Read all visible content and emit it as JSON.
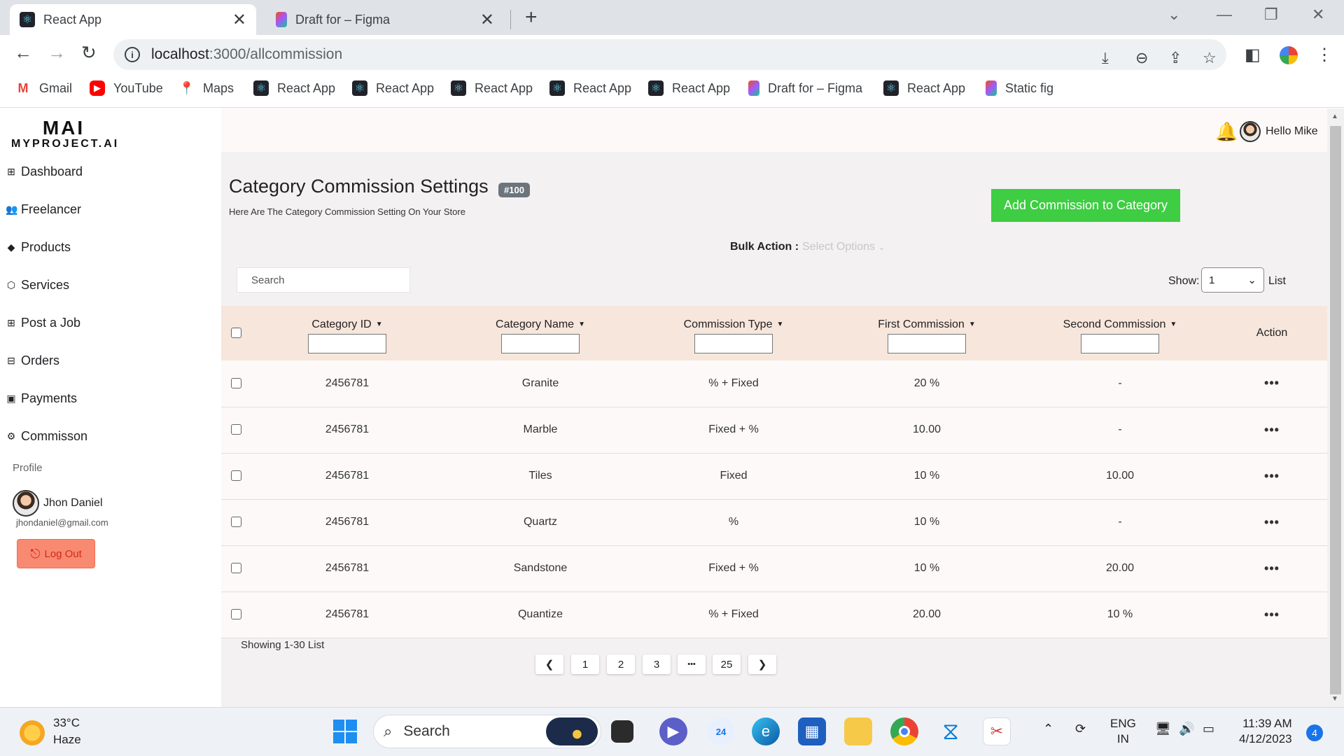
{
  "browser": {
    "tabs": [
      {
        "title": "React App",
        "close": "✕"
      },
      {
        "title": "Draft for – Figma",
        "close": "✕"
      }
    ],
    "url_host": "localhost",
    "url_rest": ":3000/allcommission",
    "bookmarks": [
      {
        "label": "Gmail",
        "icon": "gmail-icon"
      },
      {
        "label": "YouTube",
        "icon": "youtube-icon"
      },
      {
        "label": "Maps",
        "icon": "maps-icon"
      },
      {
        "label": "React App",
        "icon": "react-icon"
      },
      {
        "label": "React App",
        "icon": "react-icon"
      },
      {
        "label": "React App",
        "icon": "react-icon"
      },
      {
        "label": "React App",
        "icon": "react-icon"
      },
      {
        "label": "React App",
        "icon": "react-icon"
      },
      {
        "label": "Draft for – Figma",
        "icon": "figma-icon"
      },
      {
        "label": "React App",
        "icon": "react-icon"
      },
      {
        "label": "Static fig",
        "icon": "figma-icon"
      }
    ]
  },
  "sidebar": {
    "logo_top": "MAI",
    "logo_bottom": "MYPROJECT.AI",
    "items": [
      {
        "label": "Dashboard",
        "icon": "grid-icon"
      },
      {
        "label": "Freelancer",
        "icon": "users-icon"
      },
      {
        "label": "Products",
        "icon": "tag-icon"
      },
      {
        "label": "Services",
        "icon": "box-icon"
      },
      {
        "label": "Post a Job",
        "icon": "plus-square-icon"
      },
      {
        "label": "Orders",
        "icon": "archive-icon"
      },
      {
        "label": "Payments",
        "icon": "wallet-icon"
      },
      {
        "label": "Commisson",
        "icon": "gear-icon"
      }
    ],
    "profile_label": "Profile",
    "user_name": "Jhon Daniel",
    "user_email": "jhondaniel@gmail.com",
    "logout_label": "Log Out"
  },
  "header": {
    "greeting": "Hello Mike"
  },
  "page": {
    "title": "Category Commission Settings",
    "badge": "#100",
    "subtitle": "Here Are The Category Commission Setting On Your Store",
    "add_button": "Add Commission to Category",
    "bulk_label": "Bulk Action :",
    "bulk_placeholder": "Select Options",
    "search_placeholder": "Search",
    "show_label": "Show:",
    "show_value": "1",
    "list_label": "List"
  },
  "table": {
    "columns": [
      "Category ID",
      "Category Name",
      "Commission Type",
      "First Commission",
      "Second Commission",
      "Action"
    ],
    "rows": [
      [
        "2456781",
        "Granite",
        "% + Fixed",
        "20 %",
        "-"
      ],
      [
        "2456781",
        "Marble",
        "Fixed + %",
        "10.00",
        "-"
      ],
      [
        "2456781",
        "Tiles",
        "Fixed",
        "10 %",
        "10.00"
      ],
      [
        "2456781",
        "Quartz",
        "%",
        "10 %",
        "-"
      ],
      [
        "2456781",
        "Sandstone",
        "Fixed + %",
        "10 %",
        "20.00"
      ],
      [
        "2456781",
        "Quantize",
        "% + Fixed",
        "20.00",
        "10 %"
      ]
    ],
    "showing": "Showing 1-30 List"
  },
  "pagination": {
    "pages": [
      "1",
      "2",
      "3",
      "•••",
      "25"
    ]
  },
  "taskbar": {
    "temperature": "33°C",
    "weather": "Haze",
    "search": "Search",
    "lang_top": "ENG",
    "lang_bottom": "IN",
    "time": "11:39 AM",
    "date": "4/12/2023",
    "notifications": "4",
    "calendar_badge": "24"
  }
}
